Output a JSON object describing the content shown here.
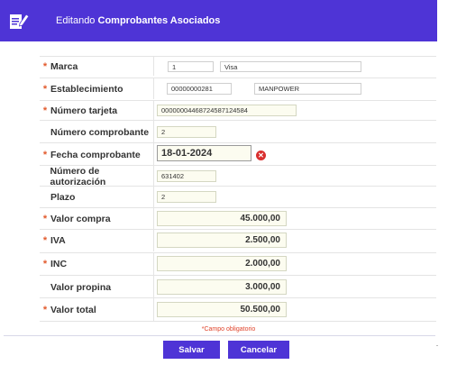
{
  "header": {
    "prefix": "Editando",
    "title": "Comprobantes Asociados",
    "icon": "edit-document-icon",
    "color": "#4e34d6"
  },
  "form": {
    "marca": {
      "label": "Marca",
      "required": true,
      "code": "1",
      "name": "Visa"
    },
    "establecimiento": {
      "label": "Establecimiento",
      "required": true,
      "code": "00000000281",
      "name": "MANPOWER"
    },
    "numero_tarjeta": {
      "label": "Número tarjeta",
      "required": true,
      "value": "00000004468724587124584"
    },
    "numero_comprobante": {
      "label": "Número comprobante",
      "required": false,
      "value": "2"
    },
    "fecha_comprobante": {
      "label": "Fecha comprobante",
      "required": true,
      "value": "18-01-2024"
    },
    "numero_autorizacion": {
      "label": "Número de autorización",
      "required": false,
      "value": "631402"
    },
    "plazo": {
      "label": "Plazo",
      "required": false,
      "value": "2"
    },
    "valor_compra": {
      "label": "Valor compra",
      "required": true,
      "value": "45.000,00"
    },
    "iva": {
      "label": "IVA",
      "required": true,
      "value": "2.500,00"
    },
    "inc": {
      "label": "INC",
      "required": true,
      "value": "2.000,00"
    },
    "valor_propina": {
      "label": "Valor propina",
      "required": false,
      "value": "3.000,00"
    },
    "valor_total": {
      "label": "Valor total",
      "required": true,
      "value": "50.500,00"
    }
  },
  "required_note": "*Campo obligatorio",
  "required_marker": "*",
  "clear_icon": "clear-date-icon",
  "buttons": {
    "save": "Salvar",
    "cancel": "Cancelar"
  }
}
